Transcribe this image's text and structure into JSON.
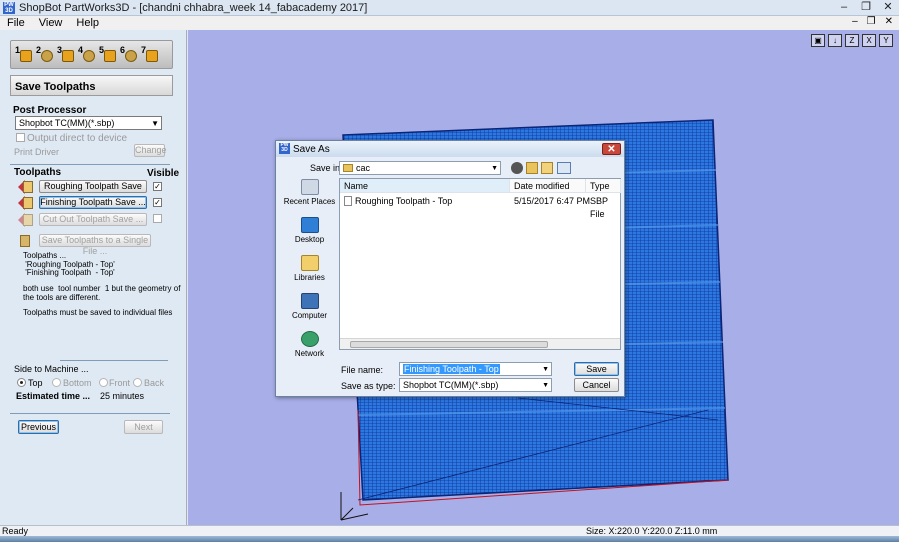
{
  "app": {
    "title": "ShopBot PartWorks3D - [chandni chhabra_week 14_fabacademy 2017]",
    "logo_text": "PW 3D"
  },
  "window_controls": {
    "minimize": "–",
    "restore": "❐",
    "close": "✕"
  },
  "mdi_controls": {
    "minimize": "–",
    "restore": "❐",
    "close": "✕"
  },
  "menu": [
    "File",
    "View",
    "Help"
  ],
  "steps": [
    "1",
    "2",
    "3",
    "4",
    "5",
    "6",
    "7"
  ],
  "panel": {
    "header": "Save Toolpaths",
    "post_processor_label": "Post Processor",
    "post_processor_value": "Shopbot TC(MM)(*.sbp)",
    "output_direct_label": "Output direct to device",
    "print_driver_label": "Print Driver",
    "change_button": "Change",
    "toolpaths_label": "Toolpaths",
    "visible_label": "Visible",
    "toolpath_buttons": [
      {
        "label": "Roughing Toolpath Save ...",
        "checked": true,
        "enabled": true
      },
      {
        "label": "Finishing Toolpath Save ...",
        "checked": true,
        "enabled": true
      },
      {
        "label": "Cut Out Toolpath Save ...",
        "checked": false,
        "enabled": false
      }
    ],
    "single_file_button": "Save Toolpaths to a Single File ...",
    "notes": [
      "Toolpaths ...",
      " 'Roughing Toolpath - Top'",
      " 'Finishing Toolpath  - Top'",
      "both use  tool number  1 but the geometry of",
      "the tools are different.",
      "Toolpaths must be saved to individual files"
    ],
    "side_label": "Side to Machine ...",
    "sides": [
      "Top",
      "Bottom",
      "Front",
      "Back"
    ],
    "selected_side": "Top",
    "estimated_label": "Estimated time ...",
    "estimated_value": "25 minutes",
    "previous_button": "Previous",
    "next_button": "Next"
  },
  "view_tools": [
    "▣",
    "↓",
    "Z",
    "X",
    "Y"
  ],
  "status": {
    "left": "Ready",
    "size": "Size: X:220.0 Y:220.0 Z:11.0 mm"
  },
  "dialog": {
    "title": "Save As",
    "close_symbol": "✕",
    "save_in_label": "Save in:",
    "save_in_value": "cac",
    "places": [
      "Recent Places",
      "Desktop",
      "Libraries",
      "Computer",
      "Network"
    ],
    "columns": [
      "Name",
      "Date modified",
      "Type"
    ],
    "files": [
      {
        "name": "Roughing Toolpath - Top",
        "date": "5/15/2017 6:47 PM",
        "type": "SBP File"
      }
    ],
    "file_name_label": "File name:",
    "file_name_value": "Finishing Toolpath  - Top",
    "save_as_type_label": "Save as type:",
    "save_as_type_value": "Shopbot TC(MM)(*.sbp)",
    "save_button": "Save",
    "cancel_button": "Cancel"
  },
  "colors": {
    "viewport_bg": "#a8aee8",
    "mesh_blue": "#1f63d8",
    "mesh_dark": "#0d2a8a",
    "outline_red": "#c1121f",
    "highlight": "#3399ff"
  }
}
